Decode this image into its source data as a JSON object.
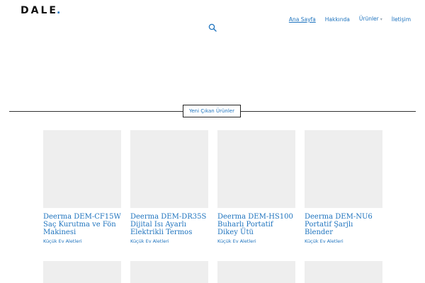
{
  "site": {
    "logo_text": "DALE",
    "logo_dot": "."
  },
  "nav": {
    "items": [
      {
        "label": "Ana Sayfa",
        "active": true
      },
      {
        "label": "Hakkında",
        "active": false
      },
      {
        "label": "Ürünler",
        "active": false,
        "has_dropdown": true
      },
      {
        "label": "İletişim",
        "active": false
      }
    ]
  },
  "section": {
    "title": "Yeni Çıkan Ürünler"
  },
  "products": [
    {
      "title": "Deerma DEM-CF15W Saç Kurutma ve Fön Makinesi",
      "category": "Küçük Ev Aletleri"
    },
    {
      "title": "Deerma DEM-DR35S Dijital Isı Ayarlı Elektrikli Termos",
      "category": "Küçük Ev Aletleri"
    },
    {
      "title": "Deerma DEM-HS100 Buharlı Portatif Dikey Ütü",
      "category": "Küçük Ev Aletleri"
    },
    {
      "title": "Deerma DEM-NU6 Portatif Şarjlı Blender",
      "category": "Küçük Ev Aletleri"
    }
  ],
  "colors": {
    "accent": "#1e73be",
    "placeholder": "#eeeeee",
    "logo": "#111111"
  },
  "icons": {
    "search": "search-icon",
    "dropdown": "chevron-down-icon"
  }
}
